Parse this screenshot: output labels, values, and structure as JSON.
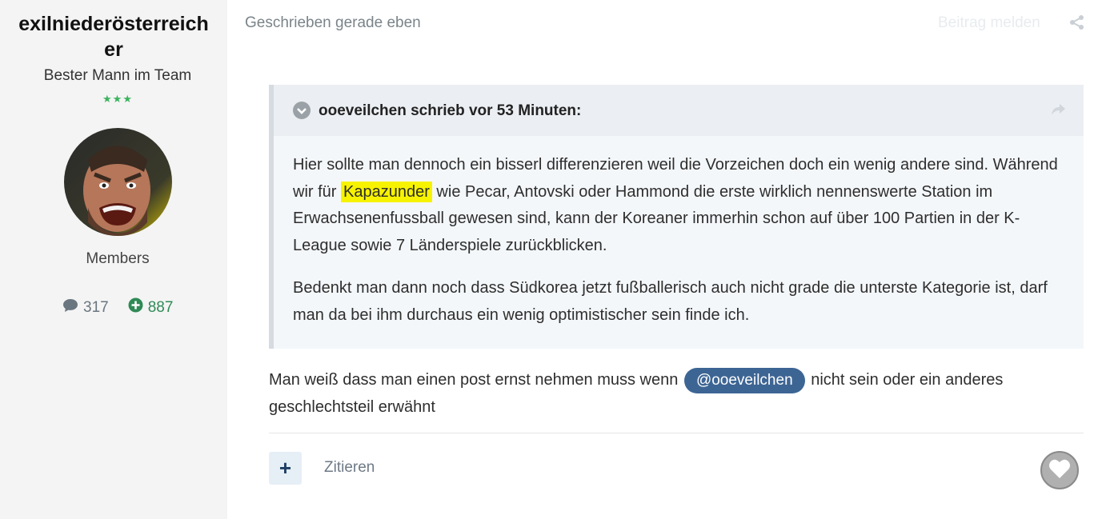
{
  "author": {
    "username": "exilniederösterreicher",
    "rank_title": "Bester Mann im Team",
    "rank_stars": "★★★",
    "group": "Members",
    "post_count": "317",
    "reputation": "887",
    "colors": {
      "stars": "#3bb35e",
      "reputation": "#2f8a56"
    }
  },
  "post": {
    "meta": "Geschrieben gerade eben",
    "report_label": "Beitrag melden",
    "quote": {
      "citation": "ooeveilchen schrieb vor 53 Minuten:",
      "p1_before": "Hier sollte man dennoch ein bisserl differenzieren weil die Vorzeichen doch ein wenig andere sind. Während wir für ",
      "p1_highlight": "Kapazunder",
      "p1_after": " wie Pecar, Antovski oder Hammond die erste wirklich nennenswerte Station im Erwachsenenfussball gewesen sind, kann der Koreaner immerhin schon auf über 100 Partien in der K-League sowie 7 Länderspiele zurückblicken.",
      "p2": "Bedenkt man dann noch dass Südkorea jetzt fußballerisch auch nicht grade die unterste Kategorie ist, darf man da bei ihm durchaus ein wenig optimistischer sein finde ich."
    },
    "body_before": "Man weiß dass man einen post ernst nehmen muss wenn ",
    "mention": "@ooeveilchen",
    "body_after": " nicht sein oder ein anderes geschlechtsteil erwähnt",
    "actions": {
      "multiquote_label": "+",
      "quote_label": "Zitieren"
    },
    "colors": {
      "mention_bg": "#3d6594",
      "highlight": "#f7f200"
    }
  },
  "icons": {
    "share": "share-icon",
    "toggle": "chevron-down-icon",
    "jump": "forward-arrow-icon",
    "posts": "comment-icon",
    "reputation": "plus-circle-icon",
    "like": "heart-icon"
  }
}
